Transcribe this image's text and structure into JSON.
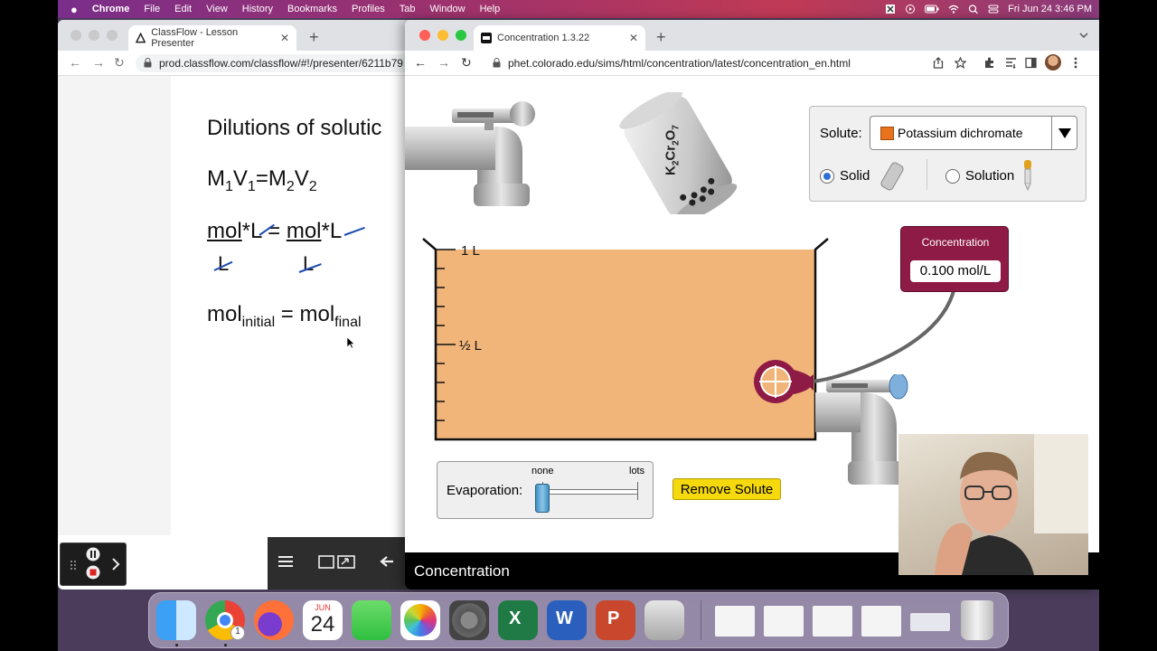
{
  "menubar": {
    "apple": "",
    "app": "Chrome",
    "items": [
      "File",
      "Edit",
      "View",
      "History",
      "Bookmarks",
      "Profiles",
      "Tab",
      "Window",
      "Help"
    ],
    "clock": "Fri Jun 24  3:46 PM"
  },
  "left_window": {
    "tab_title": "ClassFlow - Lesson Presenter",
    "url": "prod.classflow.com/classflow/#!/presenter/6211b79",
    "lesson": {
      "title": "Dilutions of solutic",
      "eq1_m1": "M",
      "eq1_s1": "1",
      "eq1_v1": "V",
      "eq1_s2": "1",
      "eq1_eq": "=M",
      "eq1_s3": "2",
      "eq1_v2": "V",
      "eq1_s4": "2",
      "units_left": "mol",
      "units_left_rest": "*L",
      "units_eq": " = ",
      "units_right": "mol",
      "units_right_rest": "*L",
      "denom_left": "L",
      "denom_right": "L",
      "mol_initial_a": "mol",
      "mol_initial_b": "initial",
      "mol_eq": " = mol",
      "mol_final": "final"
    }
  },
  "right_window": {
    "tab_title": "Concentration 1.3.22",
    "url": "phet.colorado.edu/sims/html/concentration/latest/concentration_en.html",
    "sim": {
      "solute_label": "Solute:",
      "solute_selected": "Potassium dichromate",
      "solute_color": "#e8731c",
      "form_solid": "Solid",
      "form_solution": "Solution",
      "form_selected": "Solid",
      "shaker_label_parts": [
        "K",
        "2",
        "Cr",
        "2",
        "O",
        "7"
      ],
      "beaker_mark_full": "1 L",
      "beaker_mark_half": "½ L",
      "solution_color": "#f1b57a",
      "meter_caption": "Concentration",
      "meter_value": "0.100 mol/L",
      "evaporation_label": "Evaporation:",
      "evap_min": "none",
      "evap_max": "lots",
      "evaporation_level": 0,
      "remove_solute": "Remove Solute",
      "footer_title": "Concentration"
    }
  },
  "dock": {
    "calendar_month": "JUN",
    "calendar_day": "24",
    "chrome_badge": "1"
  }
}
